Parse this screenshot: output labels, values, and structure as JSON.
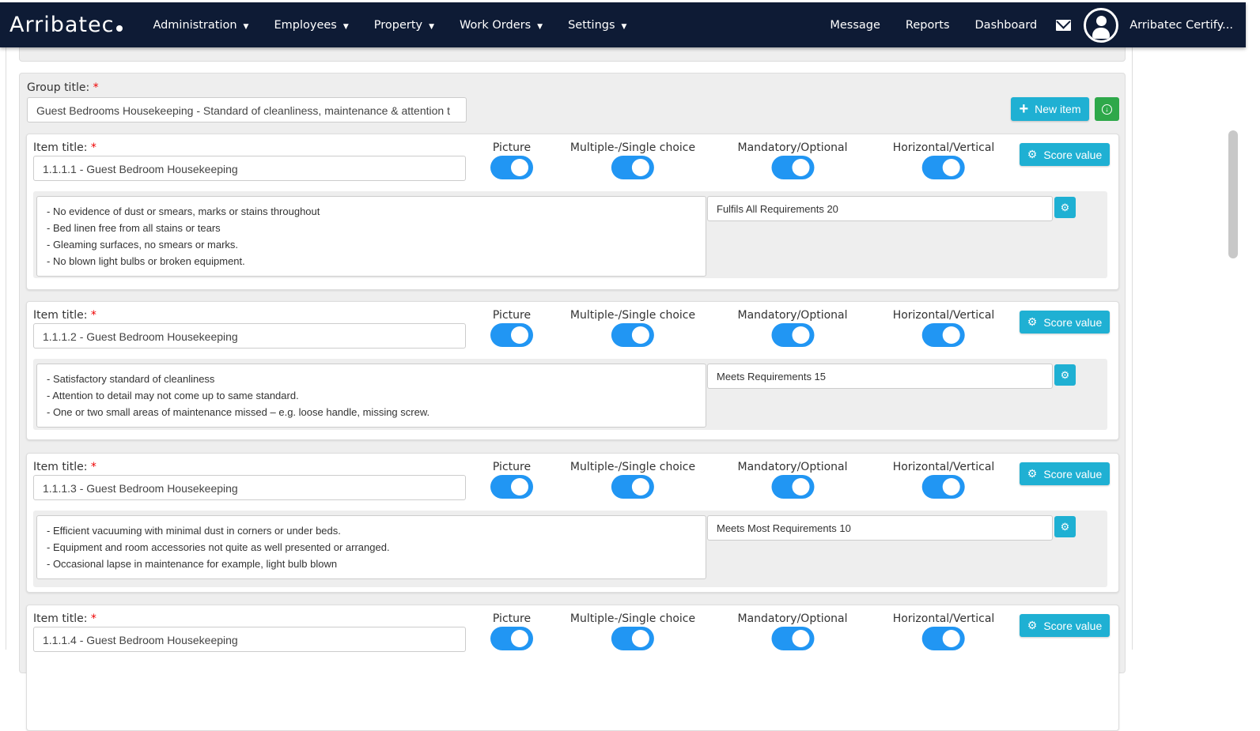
{
  "nav": {
    "logo": "Arribatec",
    "menus": [
      "Administration",
      "Employees",
      "Property",
      "Work Orders",
      "Settings"
    ],
    "links": [
      "Message",
      "Reports",
      "Dashboard"
    ],
    "user": "Arribatec Certify..."
  },
  "group": {
    "label": "Group title:",
    "required": "*",
    "value": "Guest Bedrooms Housekeeping - Standard of cleanliness, maintenance & attention t",
    "new_item": "New item"
  },
  "labels": {
    "item_title": "Item title:",
    "picture": "Picture",
    "multiple": "Multiple-/Single choice",
    "mandatory": "Mandatory/Optional",
    "horizontal": "Horizontal/Vertical",
    "score_value": "Score value"
  },
  "items": [
    {
      "title": "1.1.1.1 - Guest Bedroom Housekeeping",
      "desc": [
        "- No evidence of dust or smears, marks or stains throughout",
        "- Bed linen free from all stains or tears",
        "- Gleaming surfaces, no smears or marks.",
        "- No blown light bulbs or broken equipment."
      ],
      "score": "Fulfils All Requirements 20"
    },
    {
      "title": "1.1.1.2 - Guest Bedroom Housekeeping",
      "desc": [
        "- Satisfactory standard of cleanliness",
        "- Attention to detail may not come up to same standard.",
        "- One or two small areas of maintenance missed – e.g. loose handle, missing screw."
      ],
      "score": "Meets Requirements 15"
    },
    {
      "title": "1.1.1.3 - Guest Bedroom Housekeeping",
      "desc": [
        "- Efficient vacuuming with minimal dust in corners or under beds.",
        "- Equipment and room accessories not quite as well presented or arranged.",
        "- Occasional lapse in maintenance for example, light bulb blown"
      ],
      "score": "Meets Most Requirements 10"
    },
    {
      "title": "1.1.1.4 - Guest Bedroom Housekeeping"
    }
  ]
}
